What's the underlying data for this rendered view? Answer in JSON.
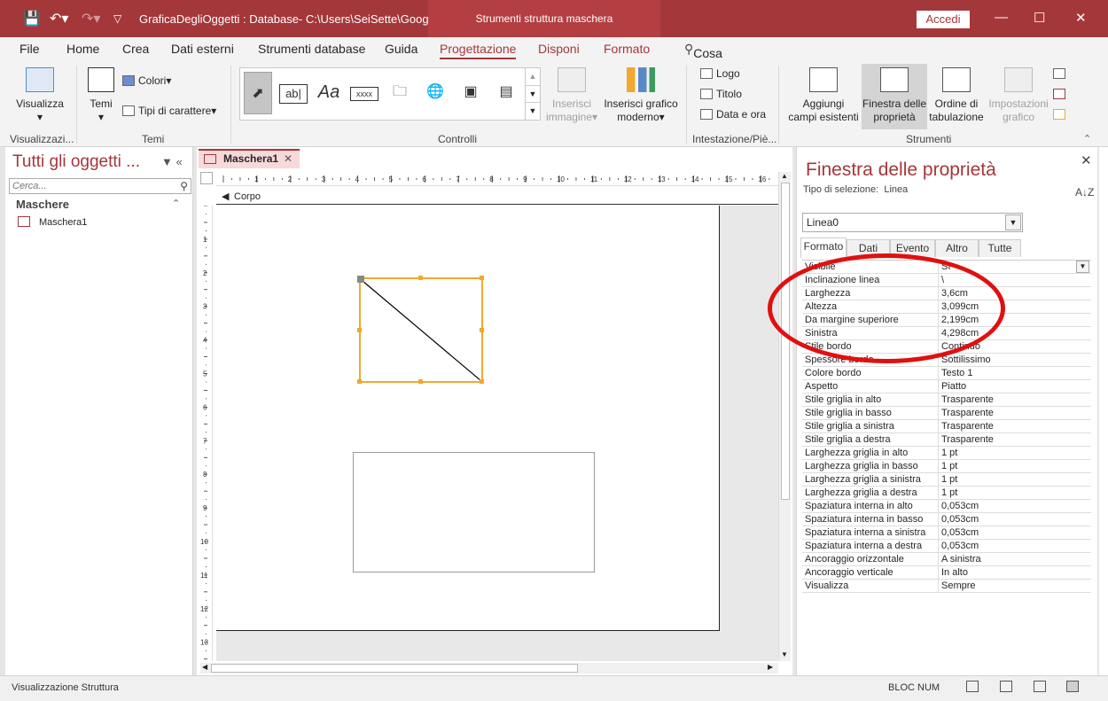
{
  "titlebar": {
    "doc_title": "GraficaDegliOggetti : Database- C:\\Users\\SeiSette\\Google...",
    "tools_title": "Strumenti struttura maschera",
    "signin": "Accedi"
  },
  "tabs": [
    "File",
    "Home",
    "Crea",
    "Dati esterni",
    "Strumenti database",
    "Guida",
    "Progettazione",
    "Disponi",
    "Formato"
  ],
  "tellme": "Cosa vuoi fare?",
  "ribbon": {
    "groups": {
      "views": "Visualizzazi...",
      "themes": "Temi",
      "controls": "Controlli",
      "header": "Intestazione/Piè...",
      "tools": "Strumenti"
    },
    "view_btn": "Visualizza",
    "themes_btn": "Temi",
    "colors_btn": "Colori",
    "fonts_btn": "Tipi di carattere",
    "insert_image_1": "Inserisci",
    "insert_image_2": "immagine",
    "insert_chart_1": "Inserisci grafico",
    "insert_chart_2": "moderno",
    "logo": "Logo",
    "title": "Titolo",
    "datetime": "Data e ora",
    "add_fields_1": "Aggiungi",
    "add_fields_2": "campi esistenti",
    "prop_sheet_1": "Finestra delle",
    "prop_sheet_2": "proprietà",
    "tab_order_1": "Ordine di",
    "tab_order_2": "tabulazione",
    "chart_settings_1": "Impostazioni",
    "chart_settings_2": "grafico",
    "ctrl_textbox": "ab|",
    "ctrl_label": "Aa",
    "ctrl_button": "xxxx"
  },
  "nav": {
    "title": "Tutti gli oggetti ...",
    "search_placeholder": "Cerca...",
    "section": "Maschere",
    "items": [
      "Maschera1"
    ]
  },
  "document": {
    "tab": "Maschera1",
    "section": "Corpo",
    "ruler_numbers": [
      "1",
      "2",
      "3",
      "4",
      "5",
      "6",
      "7",
      "8",
      "9",
      "10",
      "11",
      "12",
      "13",
      "14",
      "15",
      "16"
    ],
    "vruler_numbers": [
      "1",
      "2",
      "3",
      "4",
      "5",
      "6",
      "7",
      "8",
      "9",
      "10",
      "11",
      "12",
      "13"
    ]
  },
  "properties": {
    "title": "Finestra delle proprietà",
    "selection_label": "Tipo di selezione:",
    "selection_type": "Linea",
    "object": "Linea0",
    "tabs": [
      "Formato",
      "Dati",
      "Evento",
      "Altro",
      "Tutte"
    ],
    "rows": [
      {
        "name": "Visibile",
        "value": "Sì"
      },
      {
        "name": "Inclinazione linea",
        "value": "\\"
      },
      {
        "name": "Larghezza",
        "value": "3,6cm"
      },
      {
        "name": "Altezza",
        "value": "3,099cm"
      },
      {
        "name": "Da margine superiore",
        "value": "2,199cm"
      },
      {
        "name": "Sinistra",
        "value": "4,298cm"
      },
      {
        "name": "Stile bordo",
        "value": "Continuo"
      },
      {
        "name": "Spessore bordo",
        "value": "Sottilissimo"
      },
      {
        "name": "Colore bordo",
        "value": "Testo 1"
      },
      {
        "name": "Aspetto",
        "value": "Piatto"
      },
      {
        "name": "Stile griglia in alto",
        "value": "Trasparente"
      },
      {
        "name": "Stile griglia in basso",
        "value": "Trasparente"
      },
      {
        "name": "Stile griglia a sinistra",
        "value": "Trasparente"
      },
      {
        "name": "Stile griglia a destra",
        "value": "Trasparente"
      },
      {
        "name": "Larghezza griglia in alto",
        "value": "1 pt"
      },
      {
        "name": "Larghezza griglia in basso",
        "value": "1 pt"
      },
      {
        "name": "Larghezza griglia a sinistra",
        "value": "1 pt"
      },
      {
        "name": "Larghezza griglia a destra",
        "value": "1 pt"
      },
      {
        "name": "Spaziatura interna in alto",
        "value": "0,053cm"
      },
      {
        "name": "Spaziatura interna in basso",
        "value": "0,053cm"
      },
      {
        "name": "Spaziatura interna a sinistra",
        "value": "0,053cm"
      },
      {
        "name": "Spaziatura interna a destra",
        "value": "0,053cm"
      },
      {
        "name": "Ancoraggio orizzontale",
        "value": "A sinistra"
      },
      {
        "name": "Ancoraggio verticale",
        "value": "In alto"
      },
      {
        "name": "Visualizza",
        "value": "Sempre"
      }
    ]
  },
  "status": {
    "text": "Visualizzazione Struttura",
    "numlock": "BLOC NUM"
  },
  "colors": {
    "accent": "#a4373a",
    "selection": "#f0a830",
    "annotation": "#e01010"
  }
}
